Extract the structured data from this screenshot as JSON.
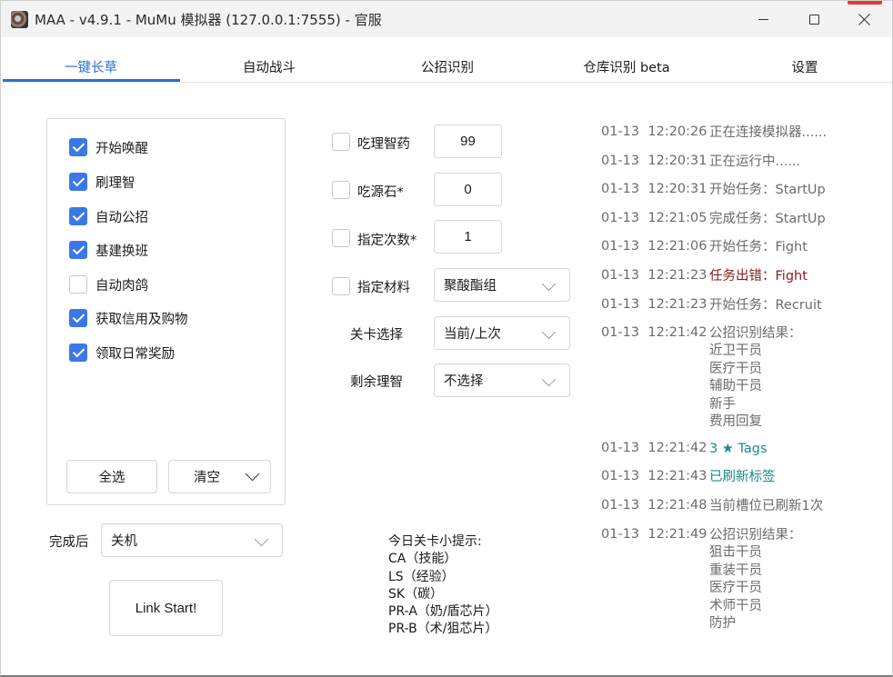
{
  "window": {
    "title": "MAA - v4.9.1 - MuMu 模拟器 (127.0.0.1:7555) - 官服"
  },
  "tabs": [
    {
      "label": "一键长草",
      "active": true
    },
    {
      "label": "自动战斗",
      "active": false
    },
    {
      "label": "公招识别",
      "active": false
    },
    {
      "label": "仓库识别 beta",
      "active": false
    },
    {
      "label": "设置",
      "active": false
    }
  ],
  "tasks": [
    {
      "label": "开始唤醒",
      "checked": true
    },
    {
      "label": "刷理智",
      "checked": true
    },
    {
      "label": "自动公招",
      "checked": true
    },
    {
      "label": "基建换班",
      "checked": true
    },
    {
      "label": "自动肉鸽",
      "checked": false
    },
    {
      "label": "获取信用及购物",
      "checked": true
    },
    {
      "label": "领取日常奖励",
      "checked": true
    }
  ],
  "task_buttons": {
    "select_all": "全选",
    "clear": "清空"
  },
  "after_complete": {
    "label": "完成后",
    "value": "关机"
  },
  "link_start": "Link Start!",
  "fight_options": {
    "medicine": {
      "label": "吃理智药",
      "checked": false,
      "value": "99"
    },
    "stone": {
      "label": "吃源石*",
      "checked": false,
      "value": "0"
    },
    "times": {
      "label": "指定次数*",
      "checked": false,
      "value": "1"
    },
    "material": {
      "label": "指定材料",
      "checked": false,
      "value": "聚酸酯组"
    },
    "stage": {
      "label": "关卡选择",
      "value": "当前/上次"
    },
    "remaining": {
      "label": "剩余理智",
      "value": "不选择"
    }
  },
  "tips": {
    "title": "今日关卡小提示:",
    "lines": [
      "CA（技能）",
      "LS（经验）",
      "SK（碳）",
      "PR-A（奶/盾芯片）",
      "PR-B（术/狙芯片）"
    ]
  },
  "log": [
    {
      "date": "01-13",
      "time": "12:20:26",
      "msg": [
        "正在连接模拟器......"
      ],
      "color": "normal"
    },
    {
      "date": "01-13",
      "time": "12:20:31",
      "msg": [
        "正在运行中......"
      ],
      "color": "normal"
    },
    {
      "date": "01-13",
      "time": "12:20:31",
      "msg": [
        "开始任务：StartUp"
      ],
      "color": "normal"
    },
    {
      "date": "01-13",
      "time": "12:21:05",
      "msg": [
        "完成任务：StartUp"
      ],
      "color": "normal"
    },
    {
      "date": "01-13",
      "time": "12:21:06",
      "msg": [
        "开始任务：Fight"
      ],
      "color": "normal"
    },
    {
      "date": "01-13",
      "time": "12:21:23",
      "msg": [
        "任务出错：Fight"
      ],
      "color": "red"
    },
    {
      "date": "01-13",
      "time": "12:21:23",
      "msg": [
        "开始任务：Recruit"
      ],
      "color": "normal"
    },
    {
      "date": "01-13",
      "time": "12:21:42",
      "msg": [
        "公招识别结果：",
        "近卫干员",
        "医疗干员",
        "辅助干员",
        "新手",
        "费用回复"
      ],
      "color": "normal"
    },
    {
      "date": "01-13",
      "time": "12:21:42",
      "msg": [
        "3 ★ Tags"
      ],
      "color": "teal"
    },
    {
      "date": "01-13",
      "time": "12:21:43",
      "msg": [
        "已刷新标签"
      ],
      "color": "teal"
    },
    {
      "date": "01-13",
      "time": "12:21:48",
      "msg": [
        "当前槽位已刷新1次"
      ],
      "color": "normal"
    },
    {
      "date": "01-13",
      "time": "12:21:49",
      "msg": [
        "公招识别结果：",
        "狙击干员",
        "重装干员",
        "医疗干员",
        "术师干员",
        "防护"
      ],
      "color": "normal"
    }
  ],
  "colors": {
    "accent": "#2b6fd6",
    "checkbox": "#3b78e7",
    "log_error": "#8b1a1a",
    "log_highlight": "#1a8c8c"
  }
}
